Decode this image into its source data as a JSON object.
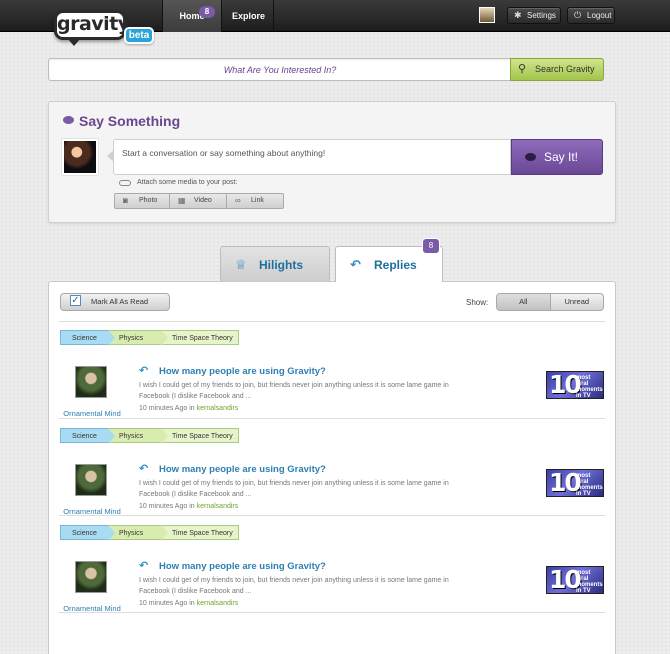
{
  "topbar": {
    "logo": "gravity",
    "beta": "beta",
    "nav": {
      "home": "Home",
      "home_badge": "8",
      "explore": "Explore"
    },
    "settings": "Settings",
    "logout": "Logout"
  },
  "search": {
    "placeholder": "What Are You Interested In?",
    "button": "Search Gravity"
  },
  "say": {
    "title": "Say Something",
    "placeholder": "Start a conversation or say something about anything!",
    "button": "Say It!",
    "attach_label": "Attach some media to your post:",
    "media": [
      "Photo",
      "Video",
      "Link"
    ]
  },
  "tabs": {
    "hilights": "Hilights",
    "replies": "Replies",
    "replies_badge": "8"
  },
  "feed": {
    "mark_read": "Mark All As Read",
    "show_label": "Show:",
    "filter_all": "All",
    "filter_unread": "Unread",
    "posts": [
      {
        "tags": [
          "Science",
          "Physics",
          "Time Space Theory"
        ],
        "author": "Ornamental Mind",
        "title": "How many people are using Gravity?",
        "body": "I wish I could get of my friends to join, but friends never join anything unless it is some lame game in Facebook (I dislike Facebook and ...",
        "time": "10 minutes Ago in",
        "user": "kernalsandirs",
        "thumb_big": "10",
        "thumb_small": "most viral moments in TV"
      },
      {
        "tags": [
          "Science",
          "Physics",
          "Time Space Theory"
        ],
        "author": "Ornamental Mind",
        "title": "How many people are using Gravity?",
        "body": "I wish I could get of my friends to join, but friends never join anything unless it is some lame game in Facebook (I dislike Facebook and ...",
        "time": "10 minutes Ago in",
        "user": "kernalsandirs",
        "thumb_big": "10",
        "thumb_small": "most viral moments in TV"
      },
      {
        "tags": [
          "Science",
          "Physics",
          "Time Space Theory"
        ],
        "author": "Ornamental Mind",
        "title": "How many people are using Gravity?",
        "body": "I wish I could get of my friends to join, but friends never join anything unless it is some lame game in Facebook (I dislike Facebook and ...",
        "time": "10 minutes Ago in",
        "user": "kernalsandirs",
        "thumb_big": "10",
        "thumb_small": "most viral moments in TV"
      }
    ]
  }
}
